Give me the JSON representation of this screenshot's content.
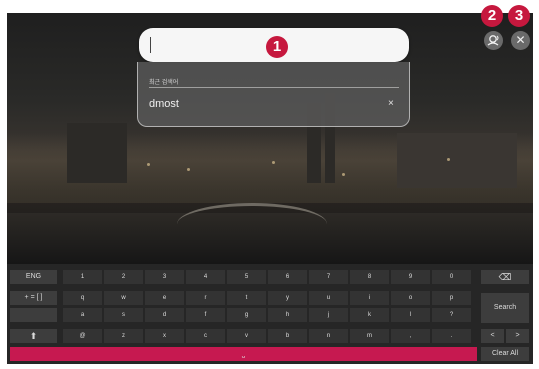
{
  "search": {
    "value": "",
    "badge": "1"
  },
  "recent": {
    "title": "최근 검색어",
    "items": [
      {
        "term": "dmost",
        "delete_glyph": "×"
      }
    ]
  },
  "top_buttons": [
    {
      "badge": "2",
      "glyph": "🎙",
      "icon": "voice-search-icon"
    },
    {
      "badge": "3",
      "glyph": "✕",
      "icon": "close-icon"
    }
  ],
  "keyboard": {
    "left_keys": [
      "ENG",
      "+ = [ ]",
      "",
      "⬆"
    ],
    "rows": [
      [
        "1",
        "2",
        "3",
        "4",
        "5",
        "6",
        "7",
        "8",
        "9",
        "0"
      ],
      [
        "q",
        "w",
        "e",
        "r",
        "t",
        "y",
        "u",
        "i",
        "o",
        "p"
      ],
      [
        "a",
        "s",
        "d",
        "f",
        "g",
        "h",
        "j",
        "k",
        "l",
        "?"
      ],
      [
        "@",
        "z",
        "x",
        "c",
        "v",
        "b",
        "n",
        "m",
        ",",
        "."
      ]
    ],
    "backspace_glyph": "⌫",
    "search_label": "Search",
    "left_arrow": "<",
    "right_arrow": ">",
    "space_glyph": "⎵",
    "clear_all_label": "Clear All"
  }
}
